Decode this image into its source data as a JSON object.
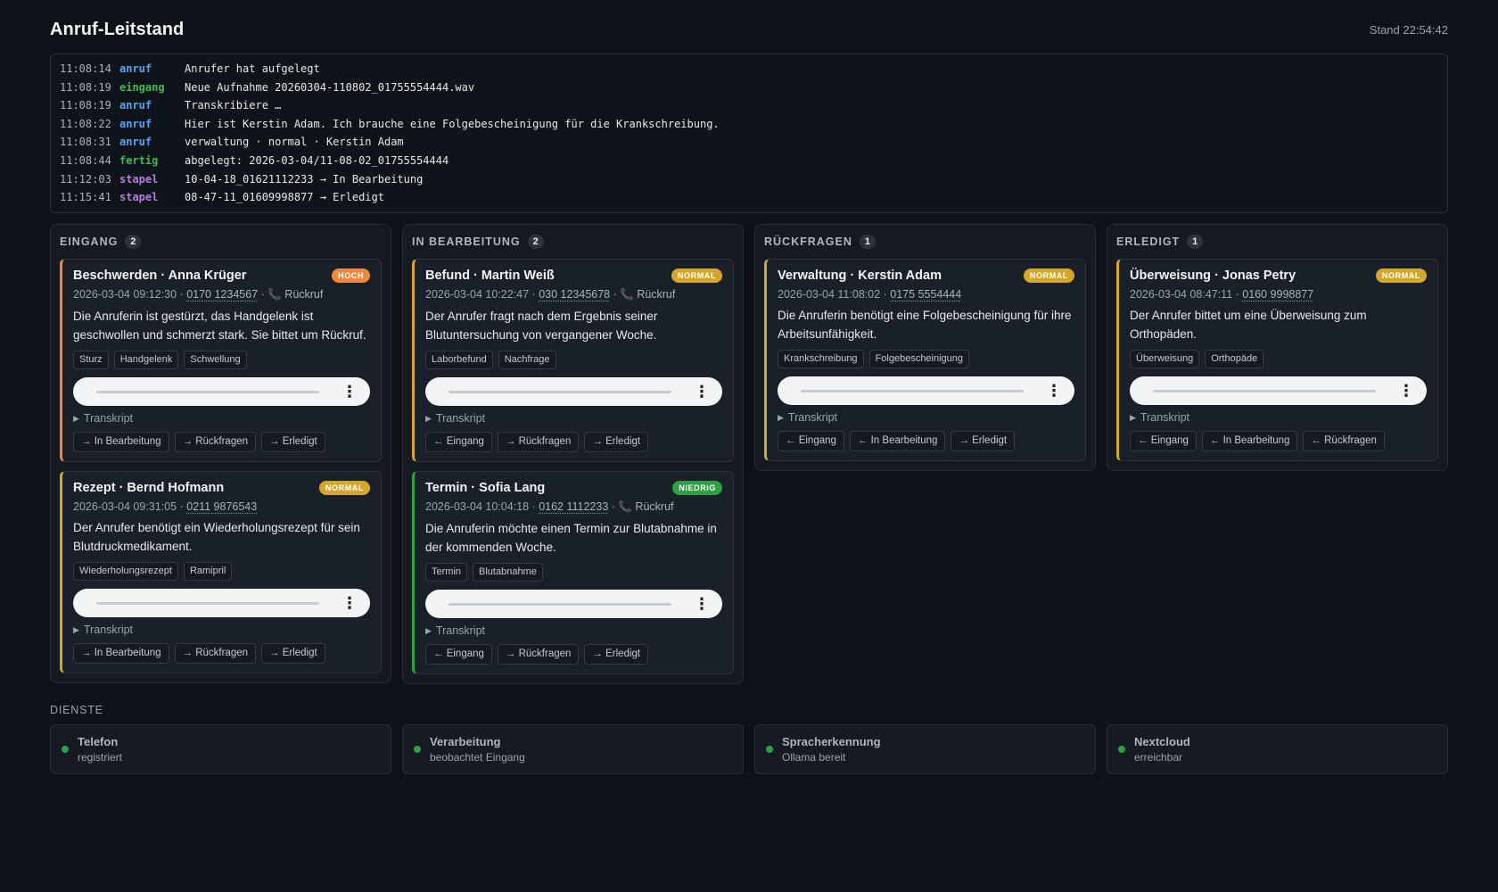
{
  "header": {
    "title": "Anruf-Leitstand",
    "stand": "Stand 22:54:42"
  },
  "log": [
    {
      "time": "11:08:14",
      "tag": "anruf",
      "msg": "Anrufer hat aufgelegt"
    },
    {
      "time": "11:08:19",
      "tag": "eingang",
      "msg": "Neue Aufnahme 20260304-110802_01755554444.wav"
    },
    {
      "time": "11:08:19",
      "tag": "anruf",
      "msg": "Transkribiere …"
    },
    {
      "time": "11:08:22",
      "tag": "anruf",
      "msg": "Hier ist Kerstin Adam. Ich brauche eine Folgebescheinigung für die Krankschreibung."
    },
    {
      "time": "11:08:31",
      "tag": "anruf",
      "msg": "verwaltung · normal · Kerstin Adam"
    },
    {
      "time": "11:08:44",
      "tag": "fertig",
      "msg": "abgelegt: 2026-03-04/11-08-02_01755554444"
    },
    {
      "time": "11:12:03",
      "tag": "stapel",
      "msg": "10-04-18_01621112233 → In Bearbeitung"
    },
    {
      "time": "11:15:41",
      "tag": "stapel",
      "msg": "08-47-11_01609998877 → Erledigt"
    }
  ],
  "columns": [
    {
      "title": "EINGANG",
      "count": "2",
      "cards": [
        {
          "title": "Beschwerden · Anna Krüger",
          "priority": "HOCH",
          "datetime": "2026-03-04 09:12:30",
          "phone": "0170 1234567",
          "callback": "📞 Rückruf",
          "text": "Die Anruferin ist gestürzt, das Handgelenk ist geschwollen und schmerzt stark. Sie bittet um Rückruf.",
          "tags": [
            "Sturz",
            "Handgelenk",
            "Schwellung"
          ],
          "transcript": "Transkript",
          "actions": [
            "→ In Bearbeitung",
            "→ Rückfragen",
            "→ Erledigt"
          ]
        },
        {
          "title": "Rezept · Bernd Hofmann",
          "priority": "NORMAL",
          "datetime": "2026-03-04 09:31:05",
          "phone": "0211 9876543",
          "callback": "",
          "text": "Der Anrufer benötigt ein Wiederholungsrezept für sein Blutdruckmedikament.",
          "tags": [
            "Wiederholungsrezept",
            "Ramipril"
          ],
          "transcript": "Transkript",
          "actions": [
            "→ In Bearbeitung",
            "→ Rückfragen",
            "→ Erledigt"
          ]
        }
      ]
    },
    {
      "title": "IN BEARBEITUNG",
      "count": "2",
      "cards": [
        {
          "title": "Befund · Martin Weiß",
          "priority": "NORMAL",
          "datetime": "2026-03-04 10:22:47",
          "phone": "030 12345678",
          "callback": "📞 Rückruf",
          "text": "Der Anrufer fragt nach dem Ergebnis seiner Blutuntersuchung von vergangener Woche.",
          "tags": [
            "Laborbefund",
            "Nachfrage"
          ],
          "transcript": "Transkript",
          "actions": [
            "← Eingang",
            "→ Rückfragen",
            "→ Erledigt"
          ]
        },
        {
          "title": "Termin · Sofia Lang",
          "priority": "NIEDRIG",
          "datetime": "2026-03-04 10:04:18",
          "phone": "0162 1112233",
          "callback": "📞 Rückruf",
          "text": "Die Anruferin möchte einen Termin zur Blutabnahme in der kommenden Woche.",
          "tags": [
            "Termin",
            "Blutabnahme"
          ],
          "transcript": "Transkript",
          "actions": [
            "← Eingang",
            "→ Rückfragen",
            "→ Erledigt"
          ]
        }
      ]
    },
    {
      "title": "RÜCKFRAGEN",
      "count": "1",
      "cards": [
        {
          "title": "Verwaltung · Kerstin Adam",
          "priority": "NORMAL",
          "datetime": "2026-03-04 11:08:02",
          "phone": "0175 5554444",
          "callback": "",
          "text": "Die Anruferin benötigt eine Folgebescheinigung für ihre Arbeitsunfähigkeit.",
          "tags": [
            "Krankschreibung",
            "Folgebescheinigung"
          ],
          "transcript": "Transkript",
          "actions": [
            "← Eingang",
            "← In Bearbeitung",
            "→ Erledigt"
          ]
        }
      ]
    },
    {
      "title": "ERLEDIGT",
      "count": "1",
      "cards": [
        {
          "title": "Überweisung · Jonas Petry",
          "priority": "NORMAL",
          "datetime": "2026-03-04 08:47:11",
          "phone": "0160 9998877",
          "callback": "",
          "text": "Der Anrufer bittet um eine Überweisung zum Orthopäden.",
          "tags": [
            "Überweisung",
            "Orthopäde"
          ],
          "transcript": "Transkript",
          "actions": [
            "← Eingang",
            "← In Bearbeitung",
            "← Rückfragen"
          ]
        }
      ]
    }
  ],
  "services_label": "DIENSTE",
  "services": [
    {
      "name": "Telefon",
      "status": "registriert"
    },
    {
      "name": "Verarbeitung",
      "status": "beobachtet Eingang"
    },
    {
      "name": "Spracherkennung",
      "status": "Ollama bereit"
    },
    {
      "name": "Nextcloud",
      "status": "erreichbar"
    }
  ],
  "colors": {
    "hoch": "#f0883e",
    "normal": "#d4a72c",
    "niedrig": "#2ea043",
    "anruf": "#5ba3f0",
    "stapel": "#b57edc"
  }
}
